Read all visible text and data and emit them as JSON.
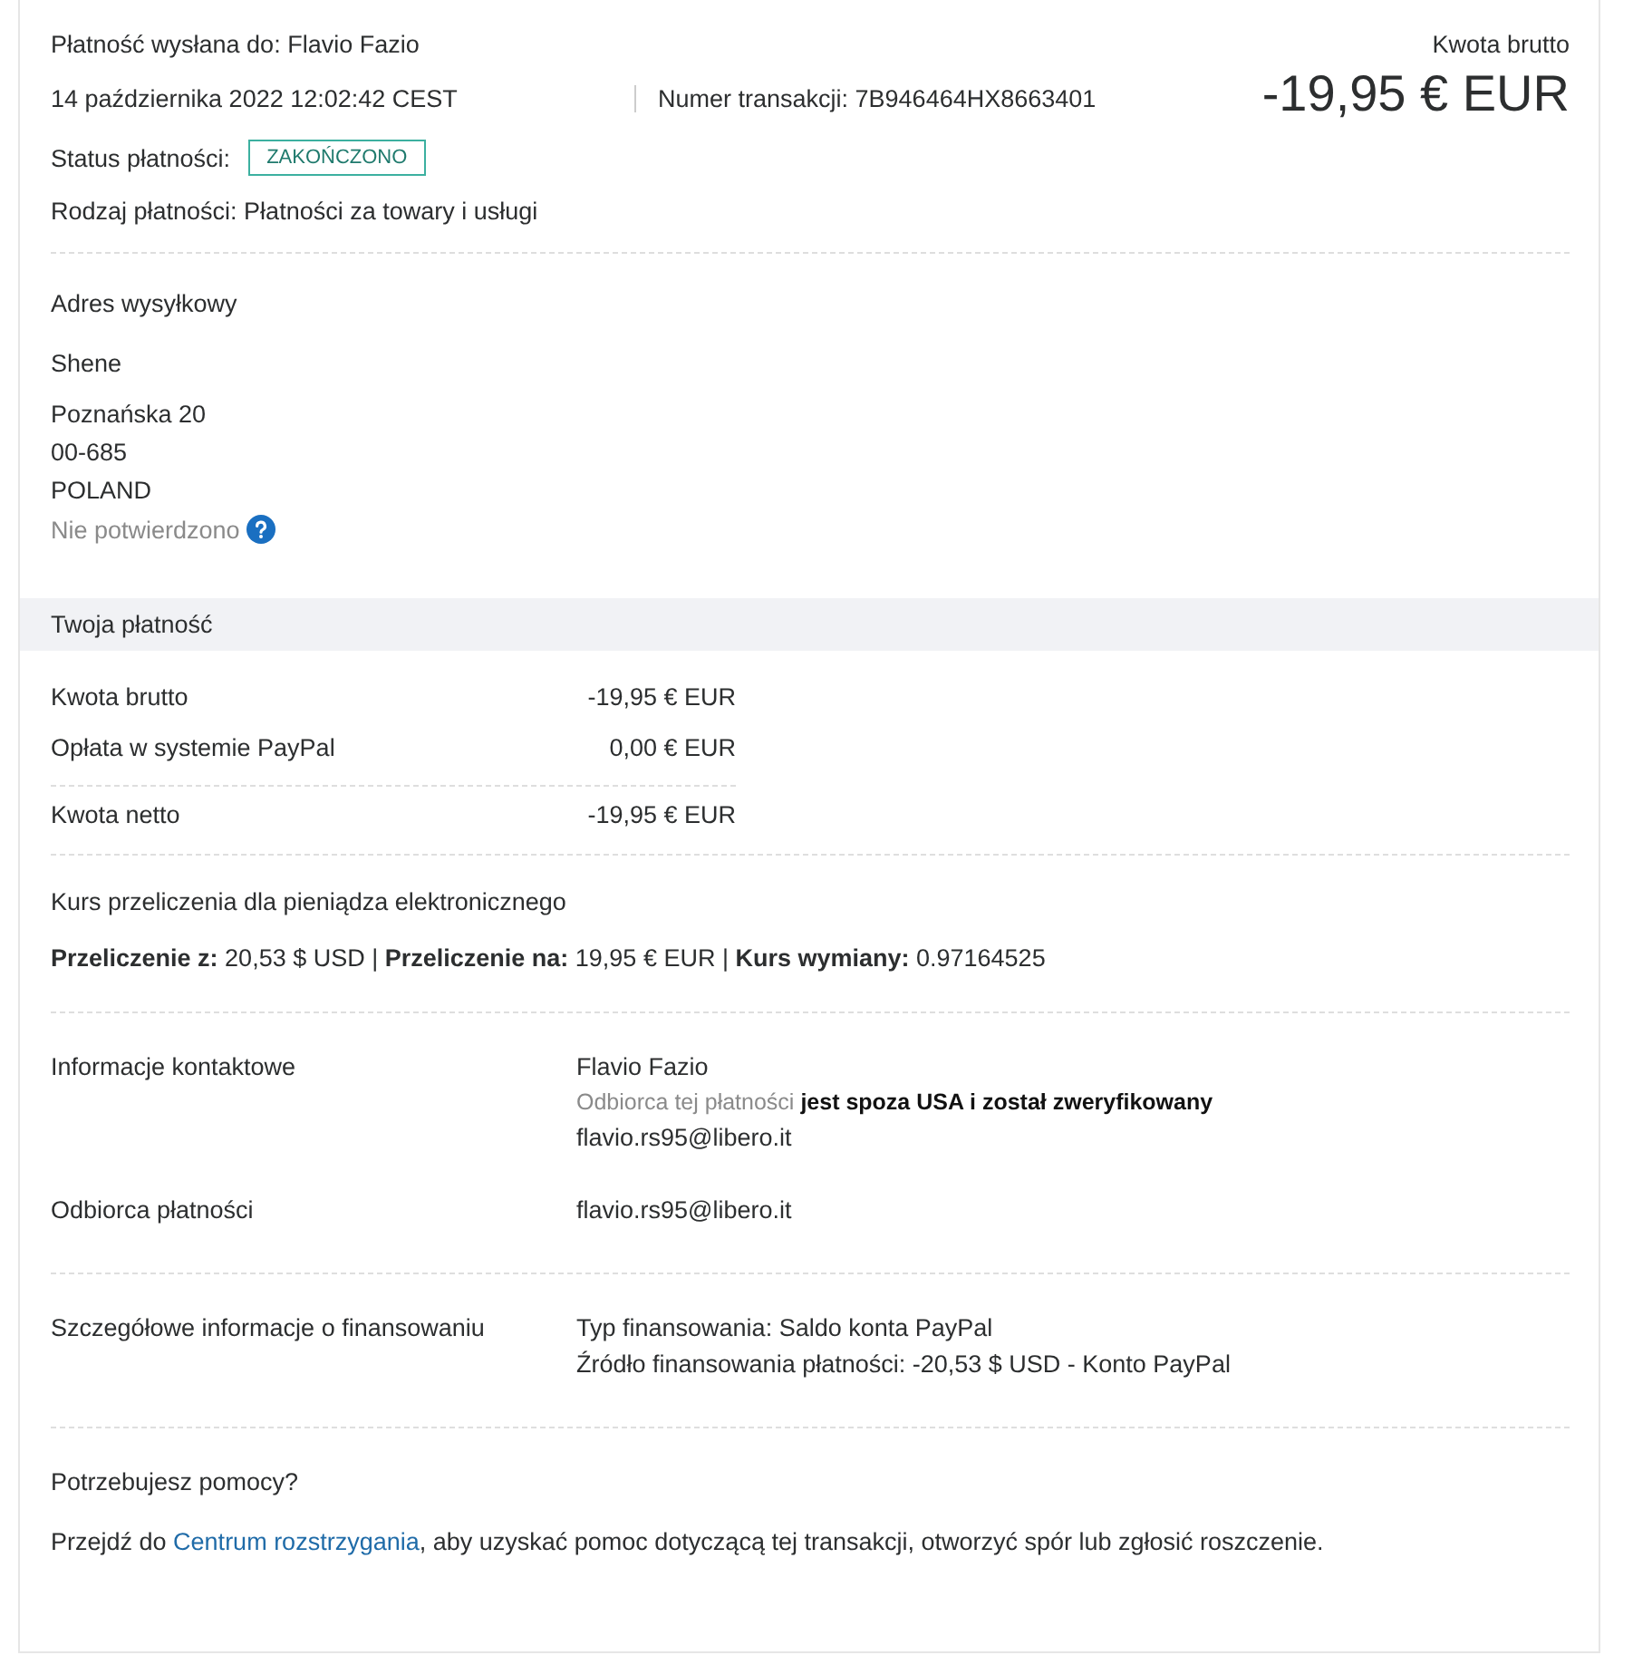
{
  "header": {
    "sent_to": "Płatność wysłana do: Flavio Fazio",
    "date": "14 października 2022 12:02:42 CEST",
    "transaction": "Numer transakcji: 7B946464HX8663401",
    "status_label": "Status płatności:",
    "status": "ZAKOŃCZONO",
    "payment_type": "Rodzaj płatności: Płatności za towary i usługi",
    "gross_label": "Kwota brutto",
    "gross_amount": "-19,95 € EUR"
  },
  "shipping": {
    "title": "Adres wysyłkowy",
    "name": "Shene",
    "lines": [
      "Poznańska 20",
      "00-685",
      "POLAND"
    ],
    "verification": "Nie potwierdzono"
  },
  "payment": {
    "title": "Twoja płatność",
    "rows": [
      {
        "label": "Kwota brutto",
        "value": "-19,95 € EUR"
      },
      {
        "label": "Opłata w systemie PayPal",
        "value": "0,00 € EUR"
      },
      {
        "label": "Kwota netto",
        "value": "-19,95 € EUR"
      }
    ]
  },
  "conversion": {
    "title": "Kurs przeliczenia dla pieniądza elektronicznego",
    "details": "**Przeliczenie z:** 20,53 $ USD  |  **Przeliczenie na:** 19,95 € EUR  |  **Kurs wymiany:** 0.97164525"
  },
  "info_rows": [
    {
      "label": "Informacje kontaktowe",
      "lines": [
        {
          "kind": "plain",
          "text": "Flavio Fazio"
        },
        {
          "kind": "note",
          "text": "Odbiorca tej płatności **jest spoza USA i został zweryfikowany**"
        },
        {
          "kind": "plain",
          "text": "flavio.rs95@libero.it"
        }
      ]
    },
    {
      "label": "Odbiorca płatności",
      "lines": [
        {
          "kind": "plain",
          "text": "flavio.rs95@libero.it"
        }
      ]
    },
    {
      "label": "Szczegółowe informacje o finansowaniu",
      "lines": [
        {
          "kind": "plain",
          "text": "Typ finansowania: Saldo konta PayPal"
        },
        {
          "kind": "plain",
          "text": "Źródło finansowania płatności: -20,53 $ USD - Konto PayPal"
        }
      ]
    }
  ],
  "help": {
    "title": "Potrzebujesz pomocy?",
    "before": "Przejdź do ",
    "link": "Centrum rozstrzygania",
    "after": ", aby uzyskać pomoc dotyczącą tej transakcji, otworzyć spór lub zgłosić roszczenie."
  }
}
